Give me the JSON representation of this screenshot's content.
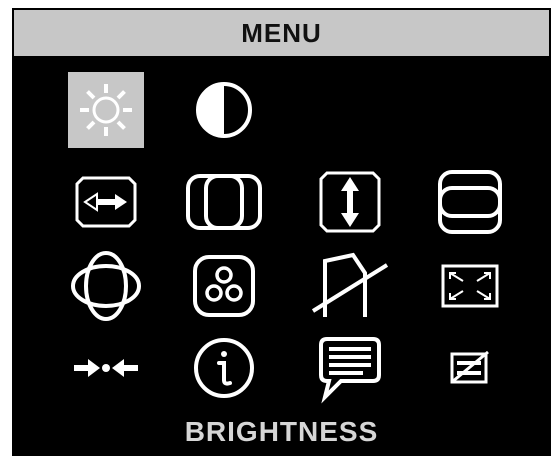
{
  "menu": {
    "title": "MENU",
    "status_label": "BRIGHTNESS",
    "selected_item": "brightness",
    "colors": {
      "background": "#000000",
      "title_bar": "#c7c7c7",
      "selection": "#c7c7c7",
      "icon": "#ffffff",
      "status_text": "#d6d6d6"
    },
    "items": [
      {
        "id": "brightness",
        "icon": "sun-icon"
      },
      {
        "id": "contrast",
        "icon": "contrast-icon"
      },
      {
        "id": "horizontal-position",
        "icon": "horizontal-arrows-icon"
      },
      {
        "id": "horizontal-size",
        "icon": "horizontal-size-icon"
      },
      {
        "id": "vertical-position",
        "icon": "vertical-arrows-icon"
      },
      {
        "id": "vertical-size",
        "icon": "vertical-size-icon"
      },
      {
        "id": "pincushion",
        "icon": "pincushion-icon"
      },
      {
        "id": "color",
        "icon": "rgb-color-icon"
      },
      {
        "id": "trapezoid",
        "icon": "trapezoid-icon"
      },
      {
        "id": "zoom",
        "icon": "zoom-icon"
      },
      {
        "id": "degauss",
        "icon": "degauss-icon"
      },
      {
        "id": "information",
        "icon": "info-icon"
      },
      {
        "id": "osd-language",
        "icon": "speech-bubble-icon"
      },
      {
        "id": "recall",
        "icon": "recall-icon"
      }
    ]
  }
}
